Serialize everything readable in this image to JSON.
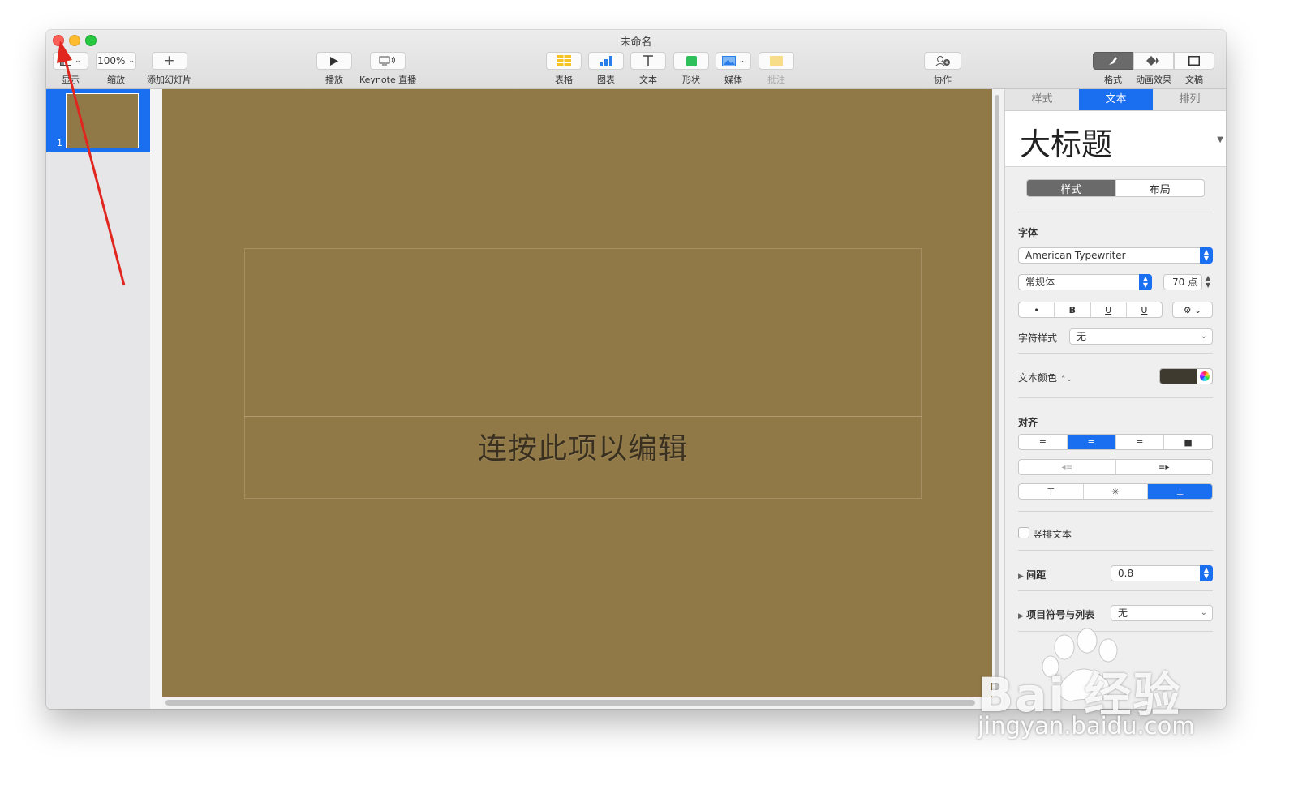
{
  "window": {
    "title": "未命名"
  },
  "toolbar": {
    "view": {
      "label": "显示"
    },
    "zoom": {
      "value": "100%",
      "label": "缩放"
    },
    "add_slide": {
      "label": "添加幻灯片"
    },
    "play": {
      "label": "播放"
    },
    "live": {
      "label": "Keynote 直播"
    },
    "table": {
      "label": "表格"
    },
    "chart": {
      "label": "图表"
    },
    "text": {
      "label": "文本"
    },
    "shape": {
      "label": "形状"
    },
    "media": {
      "label": "媒体"
    },
    "comment": {
      "label": "批注"
    },
    "collaborate": {
      "label": "协作"
    },
    "format": {
      "label": "格式"
    },
    "animate": {
      "label": "动画效果"
    },
    "document": {
      "label": "文稿"
    }
  },
  "navigator": {
    "slides": [
      {
        "number": "1"
      }
    ]
  },
  "canvas": {
    "placeholder_text": "连按此项以编辑",
    "background_color": "#917947"
  },
  "inspector": {
    "tabs": [
      "样式",
      "文本",
      "排列"
    ],
    "active_tab": "文本",
    "paragraph_style": "大标题",
    "subtabs": [
      "样式",
      "布局"
    ],
    "font": {
      "title": "字体",
      "family": "American Typewriter",
      "typeface": "常规体",
      "size": "70 点",
      "style_buttons": [
        "•",
        "B",
        "U",
        "U"
      ],
      "char_style_label": "字符样式",
      "char_style_value": "无"
    },
    "text_color": {
      "label": "文本颜色",
      "value": "#3f3a30"
    },
    "alignment": {
      "title": "对齐"
    },
    "vertical_text": {
      "label": "竖排文本"
    },
    "spacing": {
      "label": "间距",
      "value": "0.8"
    },
    "bullets": {
      "label": "项目符号与列表",
      "value": "无"
    }
  },
  "watermark": {
    "brand": "Bai 经验",
    "url": "jingyan.baidu.com"
  },
  "colors": {
    "accent": "#1a6ff0",
    "annotation_arrow": "#e0261f"
  }
}
